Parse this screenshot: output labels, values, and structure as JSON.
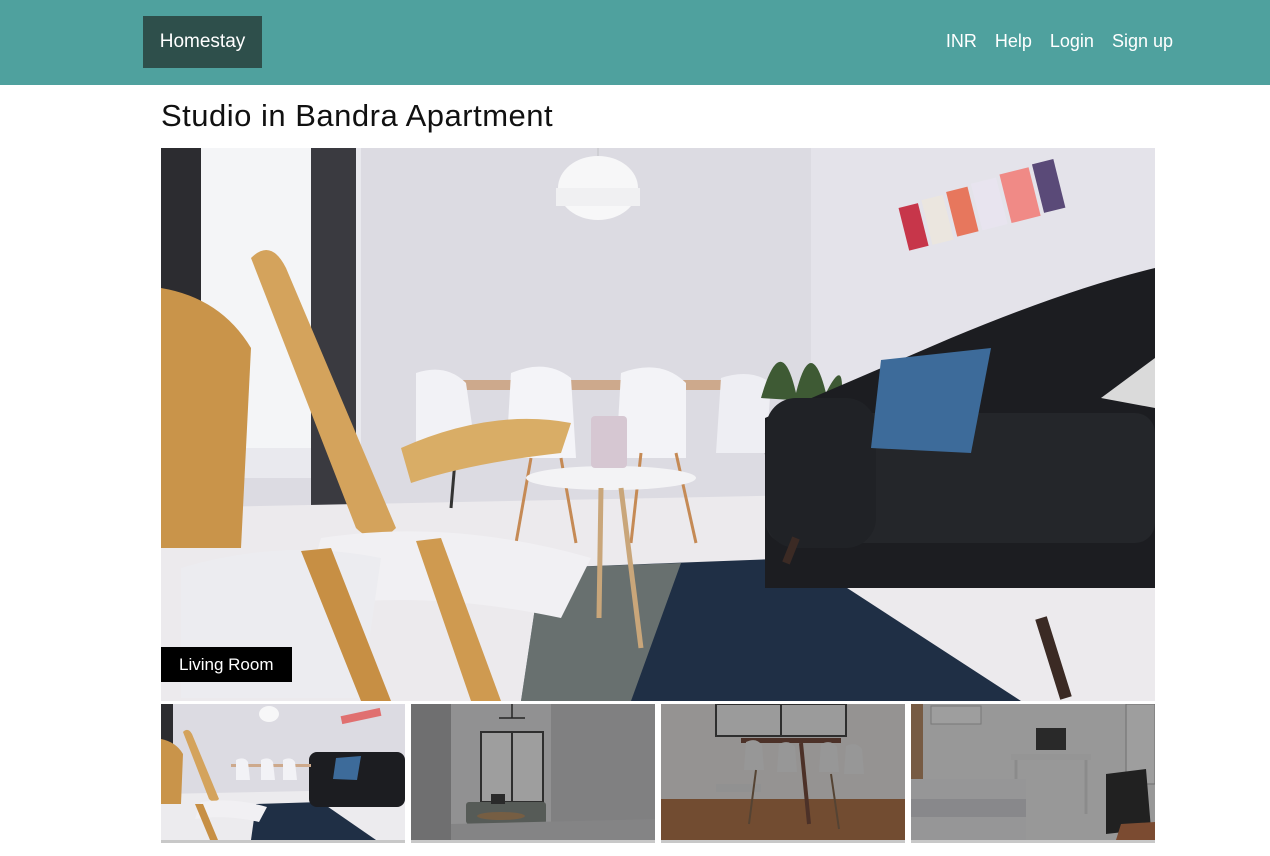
{
  "navbar": {
    "brand": "Homestay",
    "links": [
      "INR",
      "Help",
      "Login",
      "Sign up"
    ],
    "bg_color": "#4fa19e",
    "brand_bg_color": "#2e4f4b"
  },
  "listing": {
    "title": "Studio in Bandra Apartment"
  },
  "gallery": {
    "main_caption": "Living Room",
    "selected_index": 0,
    "thumbnails": [
      {
        "icon": "living-room-photo",
        "active": true
      },
      {
        "icon": "lounge-photo",
        "active": false
      },
      {
        "icon": "dining-room-photo",
        "active": false
      },
      {
        "icon": "bedroom-photo",
        "active": false
      }
    ]
  }
}
